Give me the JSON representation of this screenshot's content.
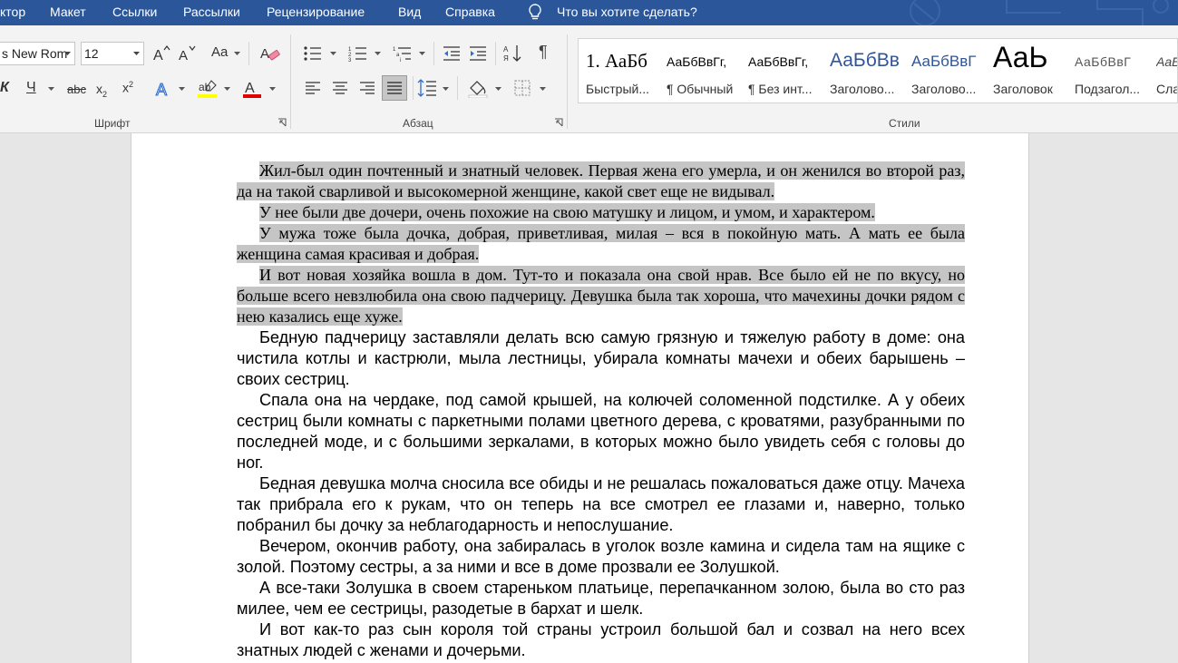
{
  "menu": {
    "tabs": [
      "ктор",
      "Макет",
      "Ссылки",
      "Рассылки",
      "Рецензирование",
      "Вид",
      "Справка"
    ],
    "tell_me": "Что вы хотите сделать?"
  },
  "ribbon": {
    "font": {
      "name": "s New Rom",
      "size": "12",
      "group_label": "Шрифт",
      "change_case": "Aa"
    },
    "paragraph": {
      "group_label": "Абзац"
    },
    "styles": {
      "group_label": "Стили",
      "items": [
        {
          "preview": "1. АаБб",
          "name": "Быстрый..."
        },
        {
          "preview": "АаБбВвГг,",
          "name": "¶ Обычный"
        },
        {
          "preview": "АаБбВвГг,",
          "name": "¶ Без инт..."
        },
        {
          "preview": "АаБбВв",
          "name": "Заголово..."
        },
        {
          "preview": "АаБбВвГ",
          "name": "Заголово..."
        },
        {
          "preview": "АаЬ",
          "name": "Заголовок"
        },
        {
          "preview": "АаБбВвГ",
          "name": "Подзагол..."
        },
        {
          "preview": "АаБ",
          "name": "Сла"
        }
      ]
    }
  },
  "document": {
    "selected_paragraphs": [
      "Жил-был один почтенный и знатный человек. Первая жена его умерла, и он женился во второй раз, да на такой сварливой и высокомерной женщине, какой свет еще не видывал.",
      "У нее были две дочери, очень похожие на свою матушку и лицом, и умом, и характером.",
      "У мужа тоже была дочка, добрая, приветливая, милая – вся в покойную мать. А мать ее была женщина самая красивая и добрая.",
      "И вот новая хозяйка вошла в дом. Тут-то и показала она свой нрав. Все было ей не по вкусу, но больше всего невзлюбила она свою падчерицу. Девушка была так хороша, что мачехины дочки рядом с нею казались еще хуже."
    ],
    "paragraphs": [
      "Бедную падчерицу заставляли делать всю самую грязную и тяжелую работу в доме: она чистила котлы и кастрюли, мыла лестницы, убирала комнаты мачехи и обеих барышень – своих сестриц.",
      "Спала она на чердаке, под самой крышей, на колючей соломенной подстилке. А у обеих сестриц были комнаты с паркетными полами цветного дерева, с кроватями, разубранными по последней моде, и с большими зеркалами, в которых можно было увидеть себя с головы до ног.",
      "Бедная девушка молча сносила все обиды и не решалась пожаловаться даже отцу. Мачеха так прибрала его к рукам, что он теперь на все смотрел ее глазами и, наверно, только побранил бы дочку за неблагодарность и непослушание.",
      "Вечером, окончив работу, она забиралась в уголок возле камина и сидела там на ящике с золой. Поэтому сестры, а за ними и все в доме прозвали ее Золушкой.",
      "А все-таки Золушка в своем стареньком платьице, перепачканном золою, была во сто раз милее, чем ее сестрицы, разодетые в бархат и шелк.",
      "И вот как-то раз сын короля той страны устроил большой бал и созвал на него всех знатных людей с женами и дочерьми."
    ]
  },
  "colors": {
    "title_bar": "#2b579a",
    "ribbon_bg": "#f3f3f3",
    "selection": "#c5c5c5",
    "highlight_yellow": "#ffff00",
    "font_color_red": "#e00000"
  }
}
